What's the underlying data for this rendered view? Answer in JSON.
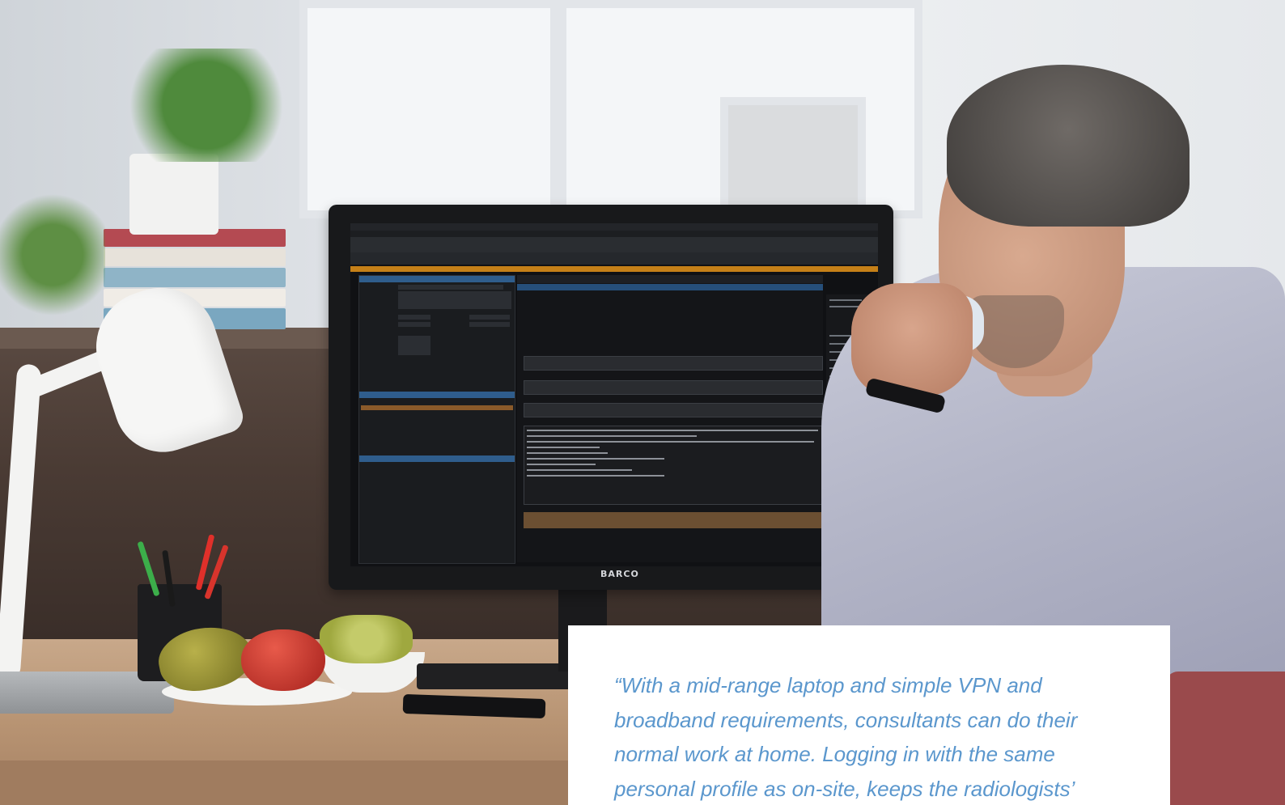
{
  "quote": {
    "text": "“With a mid-range laptop and simple VPN and broadband requirements, consultants can do their normal work at home. Logging in with the same personal profile as on-site, keeps the radiologists’"
  },
  "monitor": {
    "brand": "BARCO"
  },
  "colors": {
    "quote_text": "#5b97cd",
    "card_background": "#ffffff",
    "screen_alert_bar": "#c58018",
    "screen_panel_header": "#2f5d8c"
  }
}
